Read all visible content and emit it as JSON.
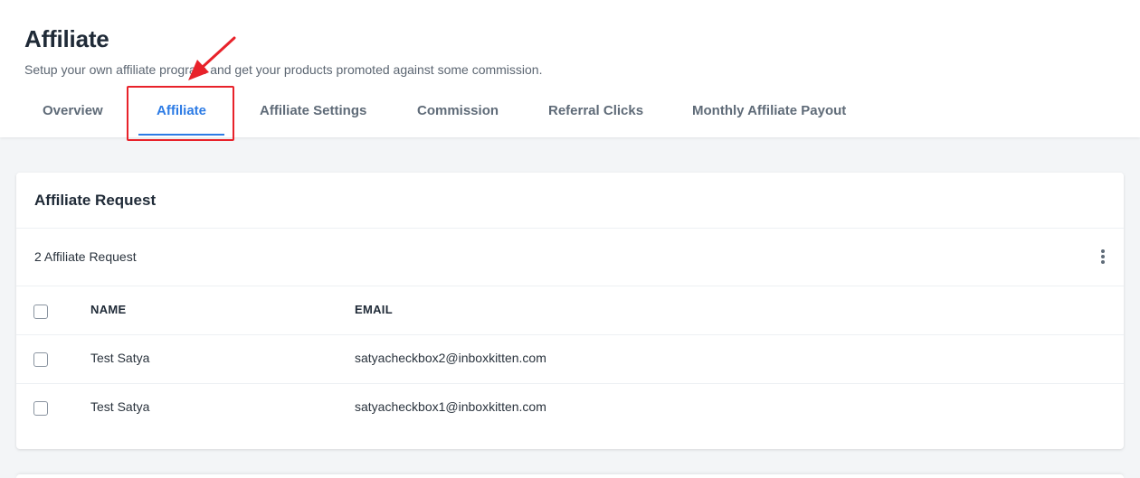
{
  "header": {
    "title": "Affiliate",
    "subtitle": "Setup your own affiliate program and get your products promoted against some commission."
  },
  "tabs": [
    {
      "label": "Overview"
    },
    {
      "label": "Affiliate",
      "active": true
    },
    {
      "label": "Affiliate Settings"
    },
    {
      "label": "Commission"
    },
    {
      "label": "Referral Clicks"
    },
    {
      "label": "Monthly Affiliate Payout"
    }
  ],
  "card": {
    "title": "Affiliate Request",
    "count_text": "2 Affiliate Request",
    "columns": [
      "NAME",
      "EMAIL"
    ],
    "rows": [
      {
        "name": "Test Satya",
        "email": "satyacheckbox2@inboxkitten.com"
      },
      {
        "name": "Test Satya",
        "email": "satyacheckbox1@inboxkitten.com"
      }
    ]
  },
  "colors": {
    "accent": "#2c7be5",
    "annotation": "#e8222a"
  }
}
